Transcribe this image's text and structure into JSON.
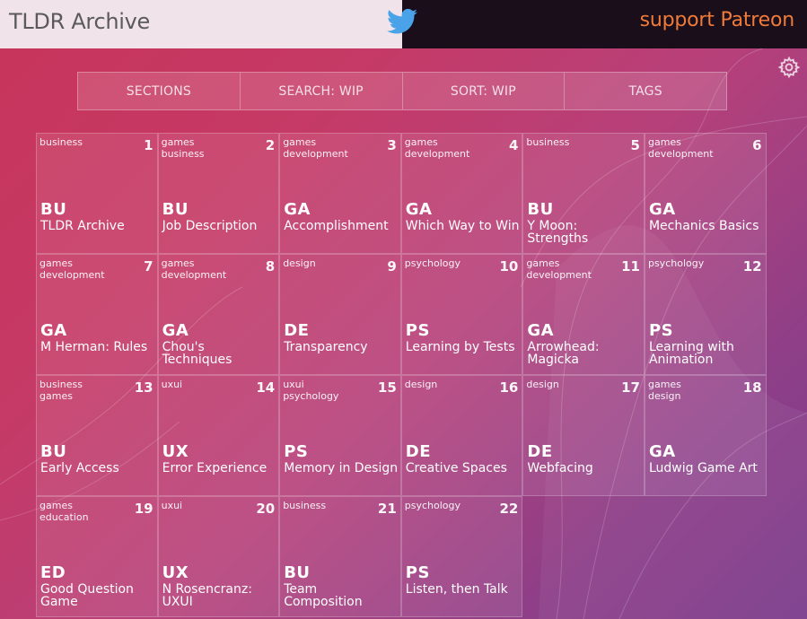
{
  "header": {
    "title": "TLDR Archive",
    "twitter_icon": "twitter-bird-icon",
    "twitter_color": "#4aa3e8",
    "patreon_label": "support Patreon",
    "patreon_color": "#ef7b3b"
  },
  "settings_icon": "gear-icon",
  "tabs": [
    {
      "label": "SECTIONS"
    },
    {
      "label": "SEARCH: WIP"
    },
    {
      "label": "SORT: WIP"
    },
    {
      "label": "TAGS"
    }
  ],
  "cards": [
    {
      "num": "1",
      "tags": [
        "business"
      ],
      "abbr": "BU",
      "title": "TLDR Archive"
    },
    {
      "num": "2",
      "tags": [
        "games",
        "business"
      ],
      "abbr": "BU",
      "title": "Job Description"
    },
    {
      "num": "3",
      "tags": [
        "games",
        "development"
      ],
      "abbr": "GA",
      "title": "Accomplishment"
    },
    {
      "num": "4",
      "tags": [
        "games",
        "development"
      ],
      "abbr": "GA",
      "title": "Which Way to Win"
    },
    {
      "num": "5",
      "tags": [
        "business"
      ],
      "abbr": "BU",
      "title": "Y Moon: Strengths"
    },
    {
      "num": "6",
      "tags": [
        "games",
        "development"
      ],
      "abbr": "GA",
      "title": "Mechanics Basics"
    },
    {
      "num": "7",
      "tags": [
        "games",
        "development"
      ],
      "abbr": "GA",
      "title": "M Herman: Rules"
    },
    {
      "num": "8",
      "tags": [
        "games",
        "development"
      ],
      "abbr": "GA",
      "title": "Chou's Techniques"
    },
    {
      "num": "9",
      "tags": [
        "design"
      ],
      "abbr": "DE",
      "title": "Transparency"
    },
    {
      "num": "10",
      "tags": [
        "psychology"
      ],
      "abbr": "PS",
      "title": "Learning by Tests"
    },
    {
      "num": "11",
      "tags": [
        "games",
        "development"
      ],
      "abbr": "GA",
      "title": "Arrowhead: Magicka"
    },
    {
      "num": "12",
      "tags": [
        "psychology"
      ],
      "abbr": "PS",
      "title": "Learning with Animation"
    },
    {
      "num": "13",
      "tags": [
        "business",
        "games"
      ],
      "abbr": "BU",
      "title": "Early Access"
    },
    {
      "num": "14",
      "tags": [
        "uxui"
      ],
      "abbr": "UX",
      "title": "Error Experience"
    },
    {
      "num": "15",
      "tags": [
        "uxui",
        "psychology"
      ],
      "abbr": "PS",
      "title": "Memory in Design"
    },
    {
      "num": "16",
      "tags": [
        "design"
      ],
      "abbr": "DE",
      "title": "Creative Spaces"
    },
    {
      "num": "17",
      "tags": [
        "design"
      ],
      "abbr": "DE",
      "title": "Webfacing"
    },
    {
      "num": "18",
      "tags": [
        "games",
        "design"
      ],
      "abbr": "GA",
      "title": "Ludwig Game Art"
    },
    {
      "num": "19",
      "tags": [
        "games",
        "education"
      ],
      "abbr": "ED",
      "title": "Good Question Game"
    },
    {
      "num": "20",
      "tags": [
        "uxui"
      ],
      "abbr": "UX",
      "title": "N Rosencranz: UXUI"
    },
    {
      "num": "21",
      "tags": [
        "business"
      ],
      "abbr": "BU",
      "title": "Team Composition"
    },
    {
      "num": "22",
      "tags": [
        "psychology"
      ],
      "abbr": "PS",
      "title": "Listen, then Talk"
    }
  ]
}
